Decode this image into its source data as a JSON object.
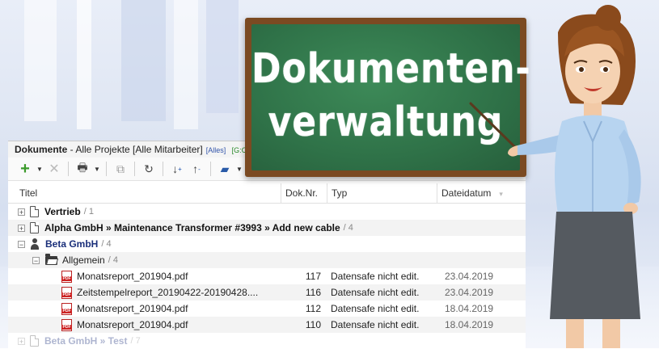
{
  "app": {
    "title_bold": "Dokumente",
    "title_rest": " - Alle Projekte [Alle Mitarbeiter]",
    "tag_all": "[Alles]",
    "tag_g": "[G:C"
  },
  "toolbar": {
    "icons": [
      "add-icon",
      "delete-icon",
      "print-icon",
      "preview-icon",
      "refresh-icon",
      "sort-down-icon",
      "sort-up-icon",
      "folder-icon",
      "calendar-icon"
    ]
  },
  "columns": {
    "titel": "Titel",
    "doknr": "Dok.Nr.",
    "typ": "Typ",
    "dateidatum": "Dateidatum"
  },
  "rows": [
    {
      "title": "Vertrieb",
      "count": "/ 1"
    },
    {
      "title": "Alpha GmbH » Maintenance Transformer #3993 » Add new cable",
      "count": "/ 4"
    },
    {
      "title": "Beta GmbH",
      "count": "/ 4"
    },
    {
      "title": "Allgemein",
      "count": "/ 4"
    },
    {
      "title": "Monatsreport_201904.pdf",
      "doknr": "117",
      "typ": "Datensafe nicht edit.",
      "date": "23.04.2019"
    },
    {
      "title": "Zeitstempelreport_20190422-20190428....",
      "doknr": "116",
      "typ": "Datensafe nicht edit.",
      "date": "23.04.2019"
    },
    {
      "title": "Monatsreport_201904.pdf",
      "doknr": "112",
      "typ": "Datensafe nicht edit.",
      "date": "18.04.2019"
    },
    {
      "title": "Monatsreport_201904.pdf",
      "doknr": "110",
      "typ": "Datensafe nicht edit.",
      "date": "18.04.2019"
    },
    {
      "title": "Beta GmbH » Test",
      "count": "/ 7"
    }
  ],
  "board": {
    "line1": "Dokumenten-",
    "line2": "verwaltung"
  },
  "colors": {
    "board_green": "#2f7248",
    "frame_brown": "#7b4a22",
    "pdf_red": "#cc2222",
    "company_blue": "#1a2f7a"
  }
}
